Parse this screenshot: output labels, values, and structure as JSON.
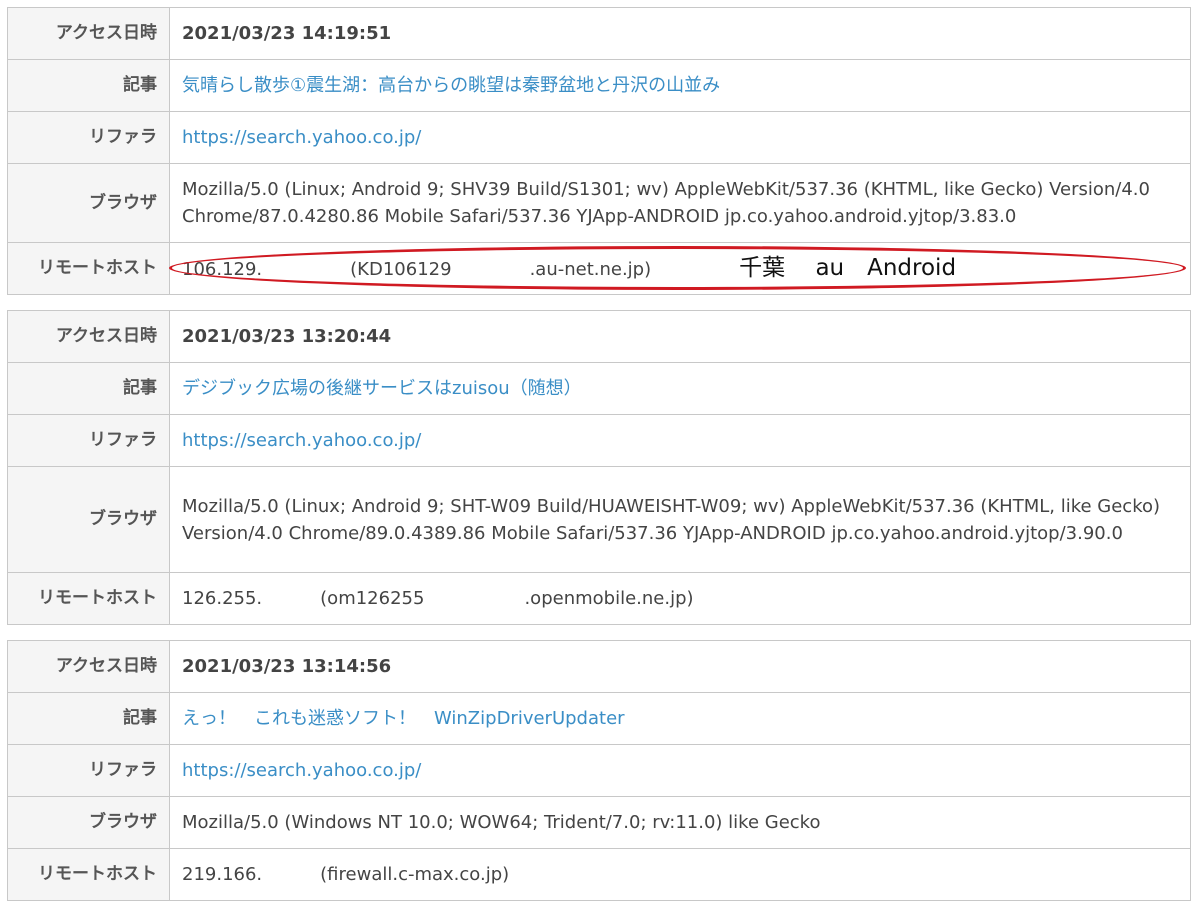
{
  "labels": {
    "date": "アクセス日時",
    "article": "記事",
    "referrer": "リファラ",
    "browser": "ブラウザ",
    "remote_host": "リモートホスト"
  },
  "entries": [
    {
      "date": "2021/03/23 14:19:51",
      "article": "気晴らし散歩①震生湖：高台からの眺望は秦野盆地と丹沢の山並み",
      "referrer": "https://search.yahoo.co.jp/",
      "browser": "Mozilla/5.0 (Linux; Android 9; SHV39 Build/S1301; wv) AppleWebKit/537.36 (KHTML, like Gecko) Version/4.0 Chrome/87.0.4280.86 Mobile Safari/537.36 YJApp-ANDROID jp.co.yahoo.android.yjtop/3.83.0",
      "host_ip": "106.129.",
      "host_name_start": "(KD106129",
      "host_name_end": ".au-net.ne.jp)",
      "annotation": "千葉　 au　Android"
    },
    {
      "date": "2021/03/23 13:20:44",
      "article": "デジブック広場の後継サービスはzuisou（随想）",
      "referrer": "https://search.yahoo.co.jp/",
      "browser": "Mozilla/5.0 (Linux; Android 9; SHT-W09 Build/HUAWEISHT-W09; wv) AppleWebKit/537.36 (KHTML, like Gecko) Version/4.0 Chrome/89.0.4389.86 Mobile Safari/537.36 YJApp-ANDROID jp.co.yahoo.android.yjtop/3.90.0",
      "host_ip": "126.255.",
      "host_name_start": "(om126255",
      "host_name_end": ".openmobile.ne.jp)"
    },
    {
      "date": "2021/03/23 13:14:56",
      "article": "えっ！　これも迷惑ソフト！　WinZipDriverUpdater",
      "referrer": "https://search.yahoo.co.jp/",
      "browser": "Mozilla/5.0 (Windows NT 10.0; WOW64; Trident/7.0; rv:11.0) like Gecko",
      "host_ip": "219.166.",
      "host_name_start": "(firewall.c-max.co.jp)"
    }
  ],
  "colors": {
    "link": "#3a8ec6",
    "highlight_oval": "#d01a22",
    "label_bg": "#f5f5f5",
    "border": "#c8c8c8"
  }
}
